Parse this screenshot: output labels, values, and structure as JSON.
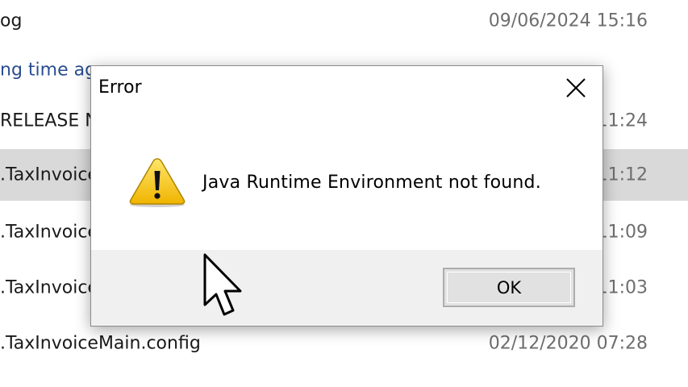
{
  "explorer": {
    "rows": [
      {
        "name": "og",
        "date": "09/06/2024 15:16",
        "selected": false
      },
      {
        "name": "ng time ag",
        "date": "",
        "selected": false,
        "group": true
      },
      {
        "name": "RELEASE N",
        "date": "11:24",
        "selected": false
      },
      {
        "name": ".TaxInvoice",
        "date": "11:12",
        "selected": true
      },
      {
        "name": ".TaxInvoice",
        "date": "11:09",
        "selected": false
      },
      {
        "name": ".TaxInvoice",
        "date": "11:03",
        "selected": false
      },
      {
        "name": ".TaxInvoiceMain.config",
        "date": "02/12/2020 07:28",
        "selected": false
      }
    ]
  },
  "dialog": {
    "title": "Error",
    "message": "Java Runtime Environment not found.",
    "ok_label": "OK",
    "icons": {
      "close": "close-icon",
      "warning": "warning-icon",
      "cursor": "mouse-pointer-icon"
    }
  },
  "colors": {
    "selected_row": "#d9d9d9",
    "footer": "#f0f0f0",
    "group_header": "#2a4d8f",
    "warning_yellow": "#f4c20d"
  }
}
